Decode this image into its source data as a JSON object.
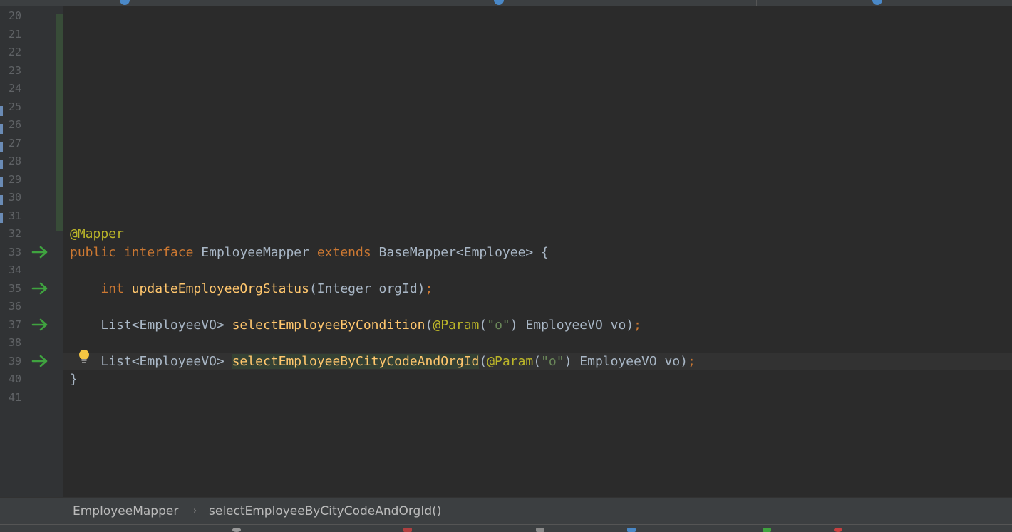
{
  "editor": {
    "line_numbers": [
      "20",
      "21",
      "22",
      "23",
      "24",
      "25",
      "26",
      "27",
      "28",
      "29",
      "30",
      "31",
      "32",
      "33",
      "34",
      "35",
      "36",
      "37",
      "38",
      "39",
      "40",
      "41"
    ],
    "implemented_lines": [
      "33",
      "35",
      "37",
      "39"
    ],
    "current_line": "39",
    "code": {
      "annotation": "@Mapper",
      "interface_decl": {
        "kw_public": "public",
        "kw_interface": "interface",
        "name": "EmployeeMapper",
        "kw_extends": "extends",
        "parent": "BaseMapper<Employee> {"
      },
      "method1": {
        "return_type": "int",
        "name": "updateEmployeeOrgStatus",
        "params": "(Integer orgId)",
        "semicolon": ";"
      },
      "method2": {
        "return_type": "List<EmployeeVO>",
        "name": "selectEmployeeByCondition",
        "open_paren": "(",
        "annotation": "@Param",
        "arg_open": "(",
        "arg_string": "\"o\"",
        "rest": ") EmployeeVO vo)",
        "semicolon": ";"
      },
      "method3": {
        "return_type": "List<EmployeeVO>",
        "name": "selectEmployeeByCityCodeAndOrgId",
        "open_paren": "(",
        "annotation": "@Param",
        "arg_open": "(",
        "arg_string": "\"o\"",
        "rest": ") EmployeeVO vo)",
        "semicolon": ";"
      },
      "closing_brace": "}"
    },
    "icons": {
      "implemented": "implemented-method-arrow-icon",
      "intention": "lightbulb-icon"
    },
    "colors": {
      "keyword": "#cc7832",
      "annotation": "#bbb529",
      "method": "#ffc66d",
      "string": "#6a8759",
      "text": "#a9b7c6",
      "gutter_arrow": "#3fa33f"
    }
  },
  "breadcrumb": {
    "items": [
      "EmployeeMapper",
      "selectEmployeeByCityCodeAndOrgId()"
    ],
    "separator": "›"
  }
}
